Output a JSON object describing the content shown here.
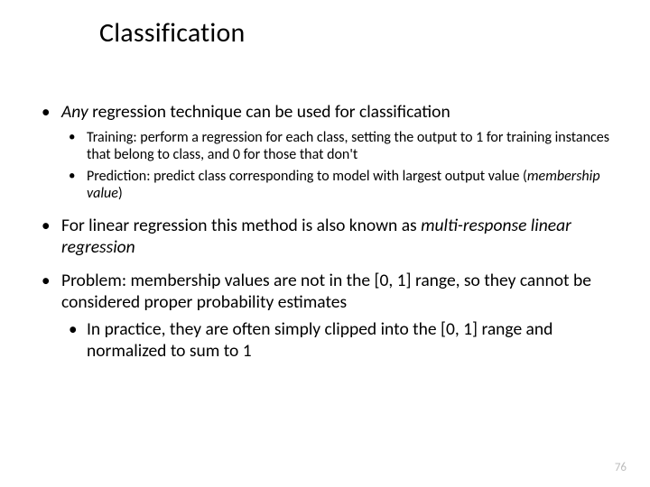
{
  "title": "Classification",
  "b1_pre_em": "Any",
  "b1_rest": " regression technique can be used for classification",
  "b1_sub1": "Training: perform a regression for each class, setting the output to 1 for training instances that belong to class, and 0 for those that don't",
  "b1_sub2_pre": "Prediction: predict class corresponding to model with largest output value (",
  "b1_sub2_em": "membership value",
  "b1_sub2_post": ")",
  "b2_pre": "For linear regression this method is also known as ",
  "b2_em": "multi-response linear regression",
  "b3": "Problem: membership values are not in the [0, 1] range, so they cannot be considered proper probability estimates",
  "b3_sub1": "In practice, they are often simply clipped into the [0, 1] range and normalized to sum to 1",
  "page_number": "76"
}
